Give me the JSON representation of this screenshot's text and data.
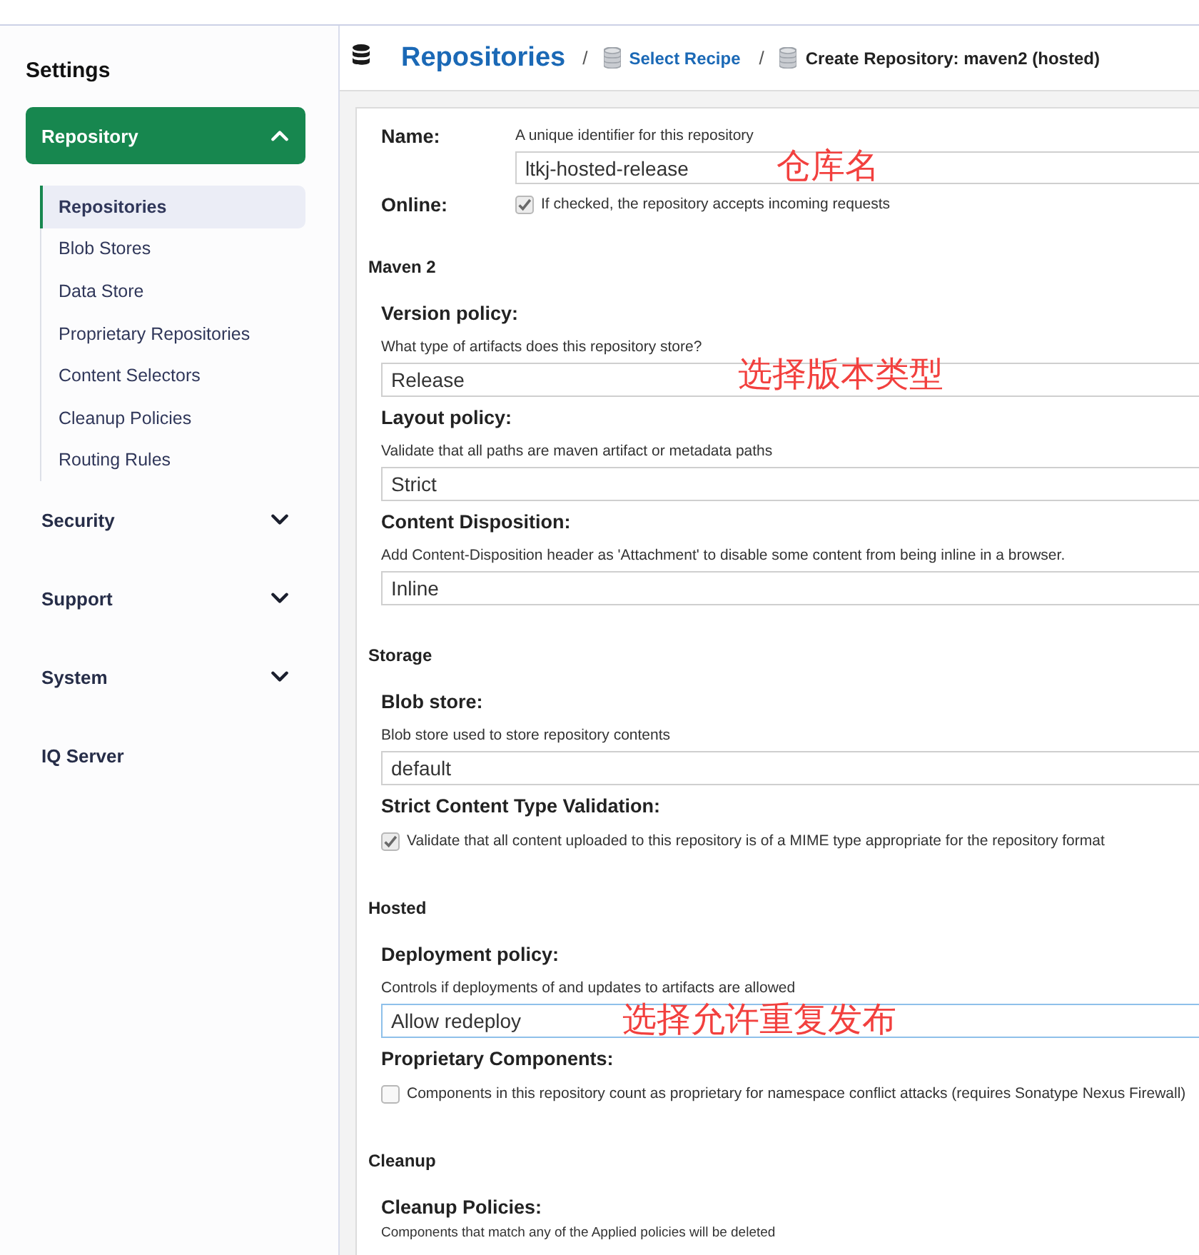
{
  "sidebar": {
    "title": "Settings",
    "groups": [
      {
        "kind": "group",
        "label": "Repository",
        "selected": true,
        "expanded": true,
        "children": [
          {
            "label": "Repositories",
            "selected": true
          },
          {
            "label": "Blob Stores",
            "selected": false
          },
          {
            "label": "Data Store",
            "selected": false
          },
          {
            "label": "Proprietary Repositories",
            "selected": false
          },
          {
            "label": "Content Selectors",
            "selected": false
          },
          {
            "label": "Cleanup Policies",
            "selected": false
          },
          {
            "label": "Routing Rules",
            "selected": false
          }
        ]
      },
      {
        "kind": "group",
        "label": "Security",
        "selected": false,
        "expanded": false
      },
      {
        "kind": "group",
        "label": "Support",
        "selected": false,
        "expanded": false
      },
      {
        "kind": "group",
        "label": "System",
        "selected": false,
        "expanded": false
      },
      {
        "kind": "link",
        "label": "IQ Server",
        "selected": false
      }
    ]
  },
  "header": {
    "title": "Repositories",
    "breadcrumbs": [
      {
        "kind": "link",
        "separator": "/",
        "label": "Select Recipe"
      },
      {
        "kind": "current",
        "separator": "/",
        "label": "Create Repository: maven2 (hosted)"
      }
    ]
  },
  "form": {
    "fields": [
      {
        "kind": "text",
        "label": "Name:",
        "help": "A unique identifier for this repository",
        "input": {
          "value": "ltkj-hosted-release",
          "focused": false
        },
        "annotation": "仓库名"
      },
      {
        "kind": "checkbox",
        "label": "Online:",
        "text": "If checked, the repository accepts incoming requests",
        "checked": true
      }
    ],
    "sections": [
      {
        "title": "Maven 2",
        "fields": [
          {
            "kind": "select",
            "label": "Version policy:",
            "help": "What type of artifacts does this repository store?",
            "input": {
              "value": "Release",
              "focused": false
            },
            "annotation": "选择版本类型"
          },
          {
            "kind": "select",
            "label": "Layout policy:",
            "help": "Validate that all paths are maven artifact or metadata paths",
            "input": {
              "value": "Strict",
              "focused": false
            }
          },
          {
            "kind": "select",
            "label": "Content Disposition:",
            "help": "Add Content-Disposition header as 'Attachment' to disable some content from being inline in a browser.",
            "input": {
              "value": "Inline",
              "focused": false
            }
          }
        ]
      },
      {
        "title": "Storage",
        "fields": [
          {
            "kind": "select",
            "label": "Blob store:",
            "help": "Blob store used to store repository contents",
            "input": {
              "value": "default",
              "focused": false
            }
          },
          {
            "kind": "checkbox",
            "label": "Strict Content Type Validation:",
            "text": "Validate that all content uploaded to this repository is of a MIME type appropriate for the repository format",
            "checked": true
          }
        ]
      },
      {
        "title": "Hosted",
        "fields": [
          {
            "kind": "select",
            "label": "Deployment policy:",
            "help": "Controls if deployments of and updates to artifacts are allowed",
            "input": {
              "value": "Allow redeploy",
              "focused": true
            },
            "annotation": "选择允许重复发布"
          },
          {
            "kind": "checkbox",
            "label": "Proprietary Components:",
            "text": "Components in this repository count as proprietary for namespace conflict attacks (requires Sonatype Nexus Firewall)",
            "checked": false
          }
        ]
      },
      {
        "title": "Cleanup",
        "fields": [
          {
            "kind": "note",
            "label": "Cleanup Policies:",
            "help": "Components that match any of the Applied policies will be deleted"
          }
        ]
      }
    ]
  }
}
